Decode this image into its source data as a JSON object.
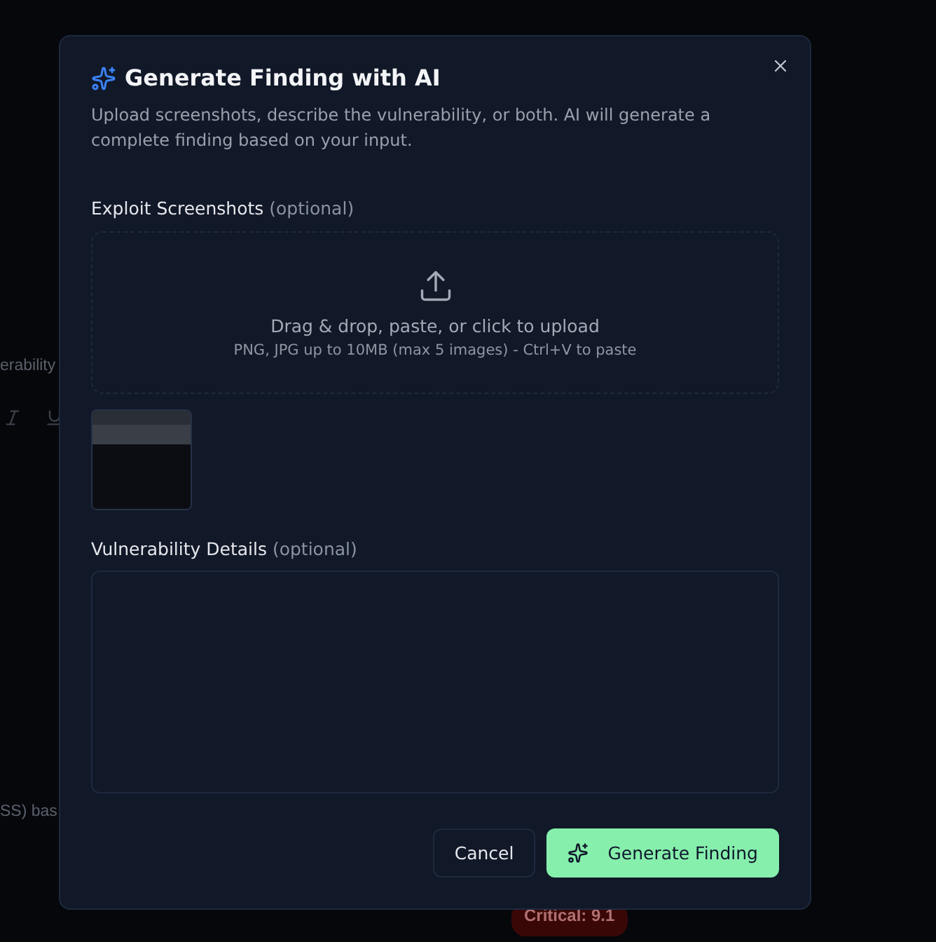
{
  "background": {
    "field_label": "erability",
    "description_fragment": "SS) bas",
    "severity_badge": "Critical: 9.1"
  },
  "dialog": {
    "title": "Generate Finding with AI",
    "description": "Upload screenshots, describe the vulnerability, or both. AI will generate a complete finding based on your input.",
    "screenshots": {
      "label": "Exploit Screenshots",
      "hint": "(optional)",
      "dropzone_text": "Drag & drop, paste, or click to upload",
      "dropzone_subtext": "PNG, JPG up to 10MB (max 5 images) - Ctrl+V to paste"
    },
    "details": {
      "label": "Vulnerability Details",
      "hint": "(optional)"
    },
    "buttons": [
      {
        "label": "Cancel",
        "kind": "secondary"
      },
      {
        "label": "Generate Finding",
        "kind": "primary"
      }
    ]
  }
}
